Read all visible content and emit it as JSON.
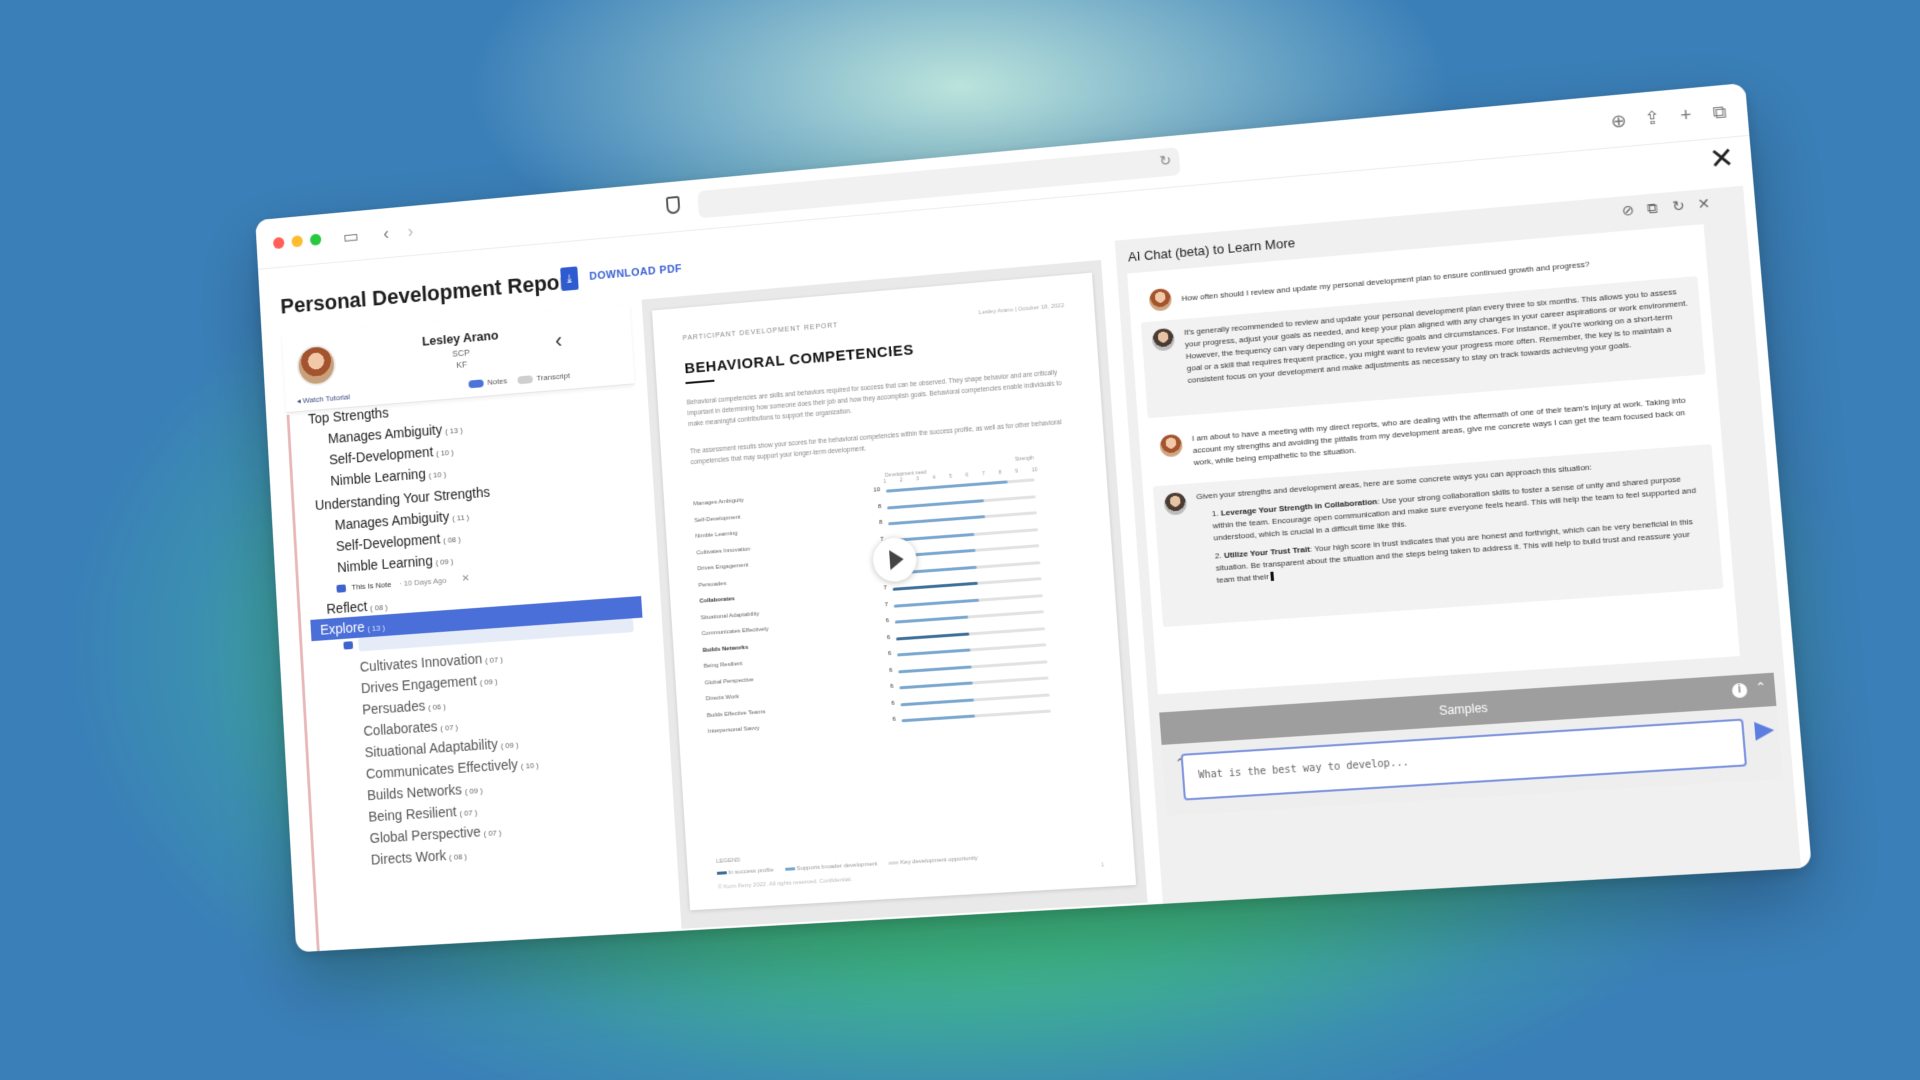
{
  "app": {
    "title": "Personal Development Report",
    "download_label": "DOWNLOAD PDF"
  },
  "profile": {
    "name": "Lesley Arano",
    "line1": "SCP",
    "line2": "KF",
    "watch_tutorial": "Watch Tutorial",
    "notes_label": "Notes",
    "transcript_label": "Transcript",
    "notes_on": true,
    "transcript_on": false
  },
  "tree": {
    "items": [
      {
        "label": "Top Strengths",
        "count": ""
      },
      {
        "label": "Manages Ambiguity",
        "count": "( 13 )"
      },
      {
        "label": "Self-Development",
        "count": "( 10 )"
      },
      {
        "label": "Nimble Learning",
        "count": "( 10 )"
      },
      {
        "label": "Understanding Your Strengths",
        "count": ""
      },
      {
        "label": "Manages Ambiguity",
        "count": "( 11 )"
      },
      {
        "label": "Self-Development",
        "count": "( 08 )"
      },
      {
        "label": "Nimble Learning",
        "count": "( 09 )"
      },
      {
        "label": "Reflect",
        "count": "( 08 )"
      },
      {
        "label": "Explore",
        "count": "( 13 )"
      },
      {
        "label": "Cultivates Innovation",
        "count": "( 07 )"
      },
      {
        "label": "Drives Engagement",
        "count": "( 09 )"
      },
      {
        "label": "Persuades",
        "count": "( 06 )"
      },
      {
        "label": "Collaborates",
        "count": "( 07 )"
      },
      {
        "label": "Situational Adaptability",
        "count": "( 09 )"
      },
      {
        "label": "Communicates Effectively",
        "count": "( 10 )"
      },
      {
        "label": "Builds Networks",
        "count": "( 09 )"
      },
      {
        "label": "Being Resilient",
        "count": "( 07 )"
      },
      {
        "label": "Global Perspective",
        "count": "( 07 )"
      },
      {
        "label": "Directs Work",
        "count": "( 08 )"
      }
    ],
    "note": {
      "text": "This Is Note",
      "age": "· 10 Days Ago",
      "close": "✕"
    }
  },
  "document": {
    "header_left": "PARTICIPANT DEVELOPMENT REPORT",
    "header_right": "Lesley Arano | October 18, 2022",
    "title": "BEHAVIORAL COMPETENCIES",
    "para1": "Behavioral competencies are skills and behaviors required for success that can be observed. They shape behavior and are critically important in determining how someone does their job and how they accomplish goals. Behavioral competencies enable individuals to make meaningful contributions to support the organization.",
    "para2": "The assessment results show your scores for the behavioral competencies within the success profile, as well as for other behavioral competencies that may support your longer-term development.",
    "scale_left": "Development need",
    "scale_right": "Strength",
    "legend_items": [
      "In success profile",
      "Supports broader development",
      "Key development opportunity"
    ],
    "legend_title": "LEGEND",
    "footer": "© Korn Ferry 2022. All rights reserved. Confidential.",
    "page": "1"
  },
  "chart_data": {
    "type": "bar",
    "categories": [
      "Manages Ambiguity",
      "Self-Development",
      "Nimble Learning",
      "Cultivates Innovation",
      "Drives Engagement",
      "Persuades",
      "Collaborates",
      "Situational Adaptability",
      "Communicates Effectively",
      "Builds Networks",
      "Being Resilient",
      "Global Perspective",
      "Directs Work",
      "Builds Effective Teams",
      "Interpersonal Savvy"
    ],
    "values": [
      10,
      8,
      8,
      7,
      7,
      7,
      7,
      7,
      6,
      6,
      6,
      6,
      6,
      6,
      6
    ],
    "bold_categories": [
      "Collaborates",
      "Builds Networks"
    ],
    "xlim": [
      1,
      10
    ],
    "ticks": [
      "1",
      "2",
      "3",
      "4",
      "5",
      "6",
      "7",
      "8",
      "9",
      "10"
    ],
    "colors": {
      "primary": "#7aa7cf",
      "dark": "#3e6f99",
      "track": "#e2e2e2"
    }
  },
  "chat": {
    "title": "AI Chat (beta) to Learn More",
    "messages": [
      {
        "role": "user",
        "text": "How often should I review and update my personal development plan to ensure continued growth and progress?"
      },
      {
        "role": "ai",
        "text": "It's generally recommended to review and update your personal development plan every three to six months. This allows you to assess your progress, adjust your goals as needed, and keep your plan aligned with any changes in your career aspirations or work environment. However, the frequency can vary depending on your specific goals and circumstances. For instance, if you're working on a short-term goal or a skill that requires frequent practice, you might want to review your progress more often. Remember, the key is to maintain a consistent focus on your development and make adjustments as necessary to stay on track towards achieving your goals."
      },
      {
        "role": "user",
        "text": "I am about to have a meeting with my direct reports, who are dealing with the aftermath of one of their team's injury at work. Taking into account my strengths and avoiding the pitfalls from my development areas, give me concrete ways I can get the team focused back on work, while being empathetic to the situation."
      },
      {
        "role": "ai",
        "intro": "Given your strengths and development areas, here are some concrete ways you can approach this situation:",
        "points": [
          {
            "head": "Leverage Your Strength in Collaboration",
            "body": ": Use your strong collaboration skills to foster a sense of unity and shared purpose within the team. Encourage open communication and make sure everyone feels heard. This will help the team to feel supported and understood, which is crucial in a difficult time like this."
          },
          {
            "head": "Utilize Your Trust Trait",
            "body": ": Your high score in trust indicates that you are honest and forthright, which can be very beneficial in this situation. Be transparent about the situation and the steps being taken to address it. This will help to build trust and reassure your team that their"
          }
        ]
      }
    ],
    "samples_label": "Samples",
    "input_placeholder": "What is the best way to develop..."
  },
  "colors": {
    "accent": "#4b6fd8",
    "link": "#3a5fd4",
    "samples_bar": "#9e9e9e"
  }
}
